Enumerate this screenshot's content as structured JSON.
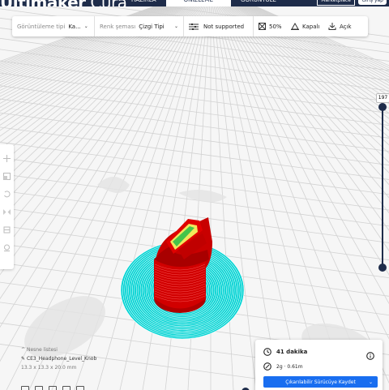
{
  "app": {
    "logo_bold": "Ultimaker",
    "logo_light": "Cura"
  },
  "stages": [
    {
      "label": "HAZIRLA",
      "active": false
    },
    {
      "label": "ÖNİZLEME",
      "active": true
    },
    {
      "label": "GÖRÜNTÜLE",
      "active": false
    }
  ],
  "header": {
    "marketplace_label": "Marketplace",
    "signin_label": "Giriş yap"
  },
  "toolbar": {
    "view_type_label": "Görüntüleme tipi",
    "view_type_value": "Ka...",
    "color_scheme_label": "Renk şeması",
    "color_scheme_value": "Çizgi Tipi",
    "support_value": "Not supported",
    "infill_value": "50%",
    "adhesion_value": "Kapalı",
    "adhesion_on_value": "Açık"
  },
  "layer_slider": {
    "top_value": "197"
  },
  "object": {
    "list_label": "Nesne listesi",
    "name": "CE3_Headphone_Level_Knob",
    "dimensions": "13.3 x 13.3 x 20.0 mm"
  },
  "print_info": {
    "time": "41 dakika",
    "material": "2g · 0.61m",
    "save_label": "Çıkarılabilir Sürücüye Kaydet"
  },
  "colors": {
    "header_bg": "#1e2c4a",
    "accent_blue": "#196ef0",
    "model_red": "#d40000",
    "skirt_cyan": "#00d9d9",
    "grid_line": "#d3d3d3"
  }
}
